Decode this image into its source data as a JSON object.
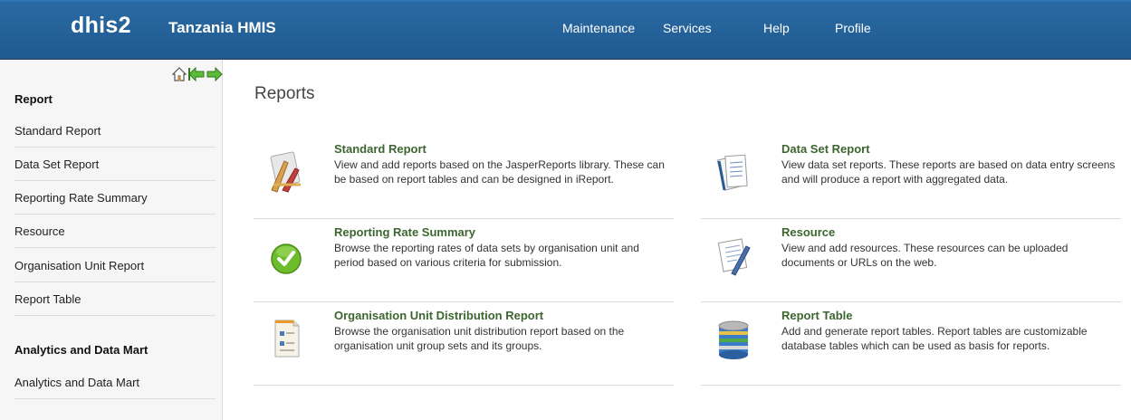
{
  "header": {
    "logo_text": "dhis",
    "logo_suffix": "2",
    "app_title": "Tanzania HMIS",
    "nav": [
      "Maintenance",
      "Services",
      "Help",
      "Profile"
    ]
  },
  "sidebar": {
    "icons": [
      "home-icon",
      "back-arrow-icon",
      "forward-arrow-icon"
    ],
    "sections": [
      {
        "heading": "Report",
        "items": [
          "Standard Report",
          "Data Set Report",
          "Reporting Rate Summary",
          "Resource",
          "Organisation Unit Report",
          "Report Table"
        ]
      },
      {
        "heading": "Analytics and Data Mart",
        "items": [
          "Analytics and Data Mart"
        ]
      }
    ]
  },
  "main": {
    "title": "Reports",
    "cards": [
      {
        "title": "Standard Report",
        "description": "View and add reports based on the JasperReports library. These can be based on report tables and can be designed in iReport.",
        "icon": "drafting-tools-icon"
      },
      {
        "title": "Data Set Report",
        "description": "View data set reports. These reports are based on data entry screens and will produce a report with aggregated data.",
        "icon": "documents-stack-icon"
      },
      {
        "title": "Reporting Rate Summary",
        "description": "Browse the reporting rates of data sets by organisation unit and period based on various criteria for submission.",
        "icon": "green-check-icon"
      },
      {
        "title": "Resource",
        "description": "View and add resources. These resources can be uploaded documents or URLs on the web.",
        "icon": "document-pen-icon"
      },
      {
        "title": "Organisation Unit Distribution Report",
        "description": "Browse the organisation unit distribution report based on the organisation unit group sets and its groups.",
        "icon": "org-chart-document-icon"
      },
      {
        "title": "Report Table",
        "description": "Add and generate report tables. Report tables are customizable database tables which can be used as basis for reports.",
        "icon": "database-icon"
      }
    ]
  },
  "colors": {
    "header_bg": "#215e96",
    "card_title": "#3d6530",
    "sidebar_bg": "#f6f6f6"
  }
}
